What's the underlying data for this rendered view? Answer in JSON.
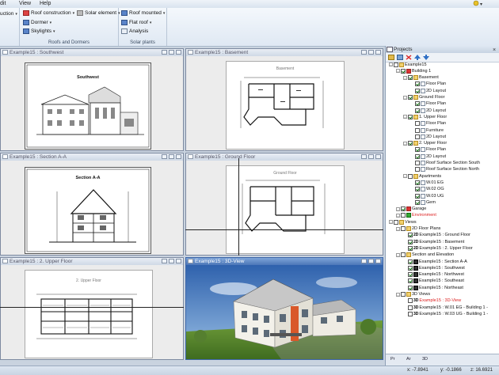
{
  "menu": {
    "items": [
      "dit",
      "View",
      "Help"
    ]
  },
  "ribbon": {
    "group1": {
      "btn1": "uction"
    },
    "group2": {
      "label": "Roofs and Dormers",
      "roof_construction": "Roof construction",
      "dormer": "Dormer",
      "skylights": "Skylights",
      "solar_element": "Solar element"
    },
    "group3": {
      "label": "Solar plants",
      "roof_mounted": "Roof mounted",
      "flat_roof": "Flat roof",
      "analysis": "Analysis"
    }
  },
  "viewports": {
    "southwest": {
      "title": "Example15 : Southwest",
      "sheet_title": "Southwest"
    },
    "basement": {
      "title": "Example15 : Basement",
      "sheet_title": "Basement"
    },
    "section": {
      "title": "Example15 : Section A-A",
      "sheet_title": "Section A-A"
    },
    "ground": {
      "title": "Example15 : Ground Floor",
      "sheet_title": "Ground Floor"
    },
    "upper": {
      "title": "Example15 : 2. Upper Floor",
      "sheet_title": "2. Upper Floor"
    },
    "view3d": {
      "title": "Example15 : 3D-View"
    }
  },
  "panel": {
    "title": "Projects",
    "tree": [
      {
        "label": "Example15",
        "level": 0,
        "icon": "folder",
        "check": false
      },
      {
        "label": "Building 1",
        "level": 1,
        "icon": "house",
        "check": true
      },
      {
        "label": "Basement",
        "level": 2,
        "icon": "folder",
        "check": true
      },
      {
        "label": "Floor Plan",
        "level": 3,
        "icon": "doc",
        "check": true
      },
      {
        "label": "2D Layout",
        "level": 3,
        "icon": "doc",
        "check": true
      },
      {
        "label": "Ground Floor",
        "level": 2,
        "icon": "folder",
        "check": true
      },
      {
        "label": "Floor Plan",
        "level": 3,
        "icon": "doc",
        "check": true
      },
      {
        "label": "2D Layout",
        "level": 3,
        "icon": "doc",
        "check": true
      },
      {
        "label": "1. Upper Floor",
        "level": 2,
        "icon": "folder",
        "check": true
      },
      {
        "label": "Floor Plan",
        "level": 3,
        "icon": "doc",
        "check": false
      },
      {
        "label": "Furniture",
        "level": 3,
        "icon": "doc",
        "check": false
      },
      {
        "label": "2D Layout",
        "level": 3,
        "icon": "doc",
        "check": false
      },
      {
        "label": "2. Upper Floor",
        "level": 2,
        "icon": "folder",
        "check": true
      },
      {
        "label": "Floor Plan",
        "level": 3,
        "icon": "doc",
        "check": true
      },
      {
        "label": "2D Layout",
        "level": 3,
        "icon": "doc",
        "check": true
      },
      {
        "label": "Roof Surface Section South",
        "level": 3,
        "icon": "doc",
        "check": false
      },
      {
        "label": "Roof Surface Section North",
        "level": 3,
        "icon": "doc",
        "check": false
      },
      {
        "label": "Apartments",
        "level": 2,
        "icon": "folder",
        "check": false
      },
      {
        "label": "W.01 EG",
        "level": 3,
        "icon": "doc",
        "check": true
      },
      {
        "label": "W.02 OG",
        "level": 3,
        "icon": "doc",
        "check": true
      },
      {
        "label": "W.03 UG",
        "level": 3,
        "icon": "doc",
        "check": true
      },
      {
        "label": "Gem",
        "level": 3,
        "icon": "doc",
        "check": true
      },
      {
        "label": "Garage",
        "level": 1,
        "icon": "house",
        "check": true
      },
      {
        "label": "Environment",
        "level": 1,
        "icon": "env",
        "check": false,
        "red": true
      },
      {
        "label": "Views",
        "level": 0,
        "icon": "folder",
        "check": false
      },
      {
        "label": "2D Floor Plans",
        "level": 1,
        "icon": "folder",
        "check": false
      },
      {
        "label": "Example15 : Ground Floor",
        "level": 2,
        "icon": "2d",
        "check": true
      },
      {
        "label": "Example15 : Basement",
        "level": 2,
        "icon": "2d",
        "check": true
      },
      {
        "label": "Example15 : 2. Upper Floor",
        "level": 2,
        "icon": "2d",
        "check": true
      },
      {
        "label": "Section and Elevation",
        "level": 1,
        "icon": "folder",
        "check": false
      },
      {
        "label": "Example15 : Section A-A",
        "level": 2,
        "icon": "view",
        "check": true
      },
      {
        "label": "Example15 : Southwest",
        "level": 2,
        "icon": "view",
        "check": true
      },
      {
        "label": "Example15 : Northwest",
        "level": 2,
        "icon": "view",
        "check": true
      },
      {
        "label": "Example15 : Southeast",
        "level": 2,
        "icon": "view",
        "check": true
      },
      {
        "label": "Example15 : Northeast",
        "level": 2,
        "icon": "view",
        "check": true
      },
      {
        "label": "3D Views",
        "level": 1,
        "icon": "folder",
        "check": false
      },
      {
        "label": "Example15 : 3D-View",
        "level": 2,
        "icon": "3d",
        "check": false,
        "red": true
      },
      {
        "label": "Example15 : W.01 EG - Building 1 -",
        "level": 2,
        "icon": "3d",
        "check": false
      },
      {
        "label": "Example15 : W.03 UG - Building 1 -",
        "level": 2,
        "icon": "3d",
        "check": false
      }
    ],
    "tabs": [
      "Pr",
      "Ar",
      "3D"
    ]
  },
  "status": {
    "x": "x: -7.8941",
    "y": "y: -0.1866",
    "z": "z: 16.6921"
  }
}
